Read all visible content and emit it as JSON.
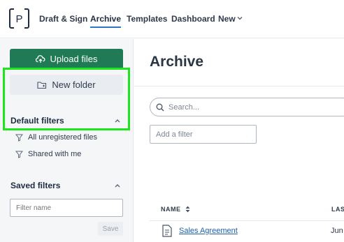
{
  "nav": {
    "logo_letter": "P",
    "items": [
      "Draft & Sign",
      "Archive",
      "Templates",
      "Dashboard"
    ],
    "new_label": "New",
    "active": "Archive"
  },
  "sidebar": {
    "upload_label": "Upload files",
    "new_folder_label": "New folder",
    "default_filters": {
      "title": "Default filters",
      "items": [
        "All unregistered files",
        "Shared with me"
      ]
    },
    "saved_filters": {
      "title": "Saved filters",
      "input_placeholder": "Filter name",
      "save_label": "Save"
    }
  },
  "main": {
    "title": "Archive",
    "search_placeholder": "Search...",
    "add_filter_placeholder": "Add a filter",
    "columns": [
      "NAME",
      "LAS"
    ],
    "rows": [
      {
        "name": "Sales Agreement",
        "date": "Jun"
      }
    ]
  },
  "colors": {
    "accent_green": "#1f7a55",
    "link_blue": "#1f5fa8",
    "active_underline": "#2a78c4",
    "highlight": "#1ee61e"
  }
}
